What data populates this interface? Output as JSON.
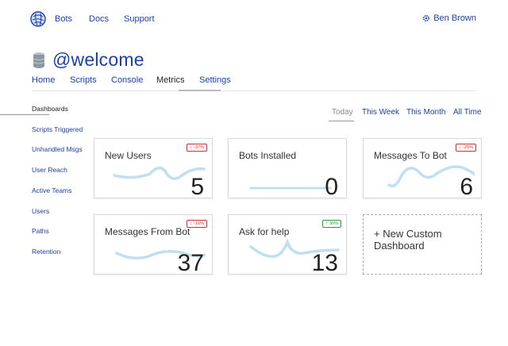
{
  "topnav": {
    "links": [
      "Bots",
      "Docs",
      "Support"
    ],
    "user": "Ben Brown"
  },
  "page": {
    "title": "@welcome"
  },
  "tabs": [
    "Home",
    "Scripts",
    "Console",
    "Metrics",
    "Settings"
  ],
  "active_tab": "Metrics",
  "sidebar": {
    "items": [
      "Dashboards",
      "Scripts Triggered",
      "Unhandled Msgs",
      "User Reach",
      "Active Teams",
      "Users",
      "Paths",
      "Retention"
    ],
    "active": "Dashboards"
  },
  "time_ranges": [
    "Today",
    "This Week",
    "This Month",
    "All Time"
  ],
  "active_range": "Today",
  "cards": [
    {
      "label": "New Users",
      "value": "5",
      "badge": "-37%",
      "trend": "down"
    },
    {
      "label": "Bots Installed",
      "value": "0",
      "badge": "",
      "trend": "none"
    },
    {
      "label": "Messages To Bot",
      "value": "6",
      "badge": "-25%",
      "trend": "down"
    },
    {
      "label": "Messages From Bot",
      "value": "37",
      "badge": "-16%",
      "trend": "down"
    },
    {
      "label": "Ask for help",
      "value": "13",
      "badge": "30%",
      "trend": "up"
    }
  ],
  "custom_card": {
    "label": "+ New Custom Dashboard"
  },
  "colors": {
    "link": "#1a3fb0",
    "sparkline": "#bfe0f0",
    "down": "#d03030",
    "up": "#2a9a3a"
  }
}
